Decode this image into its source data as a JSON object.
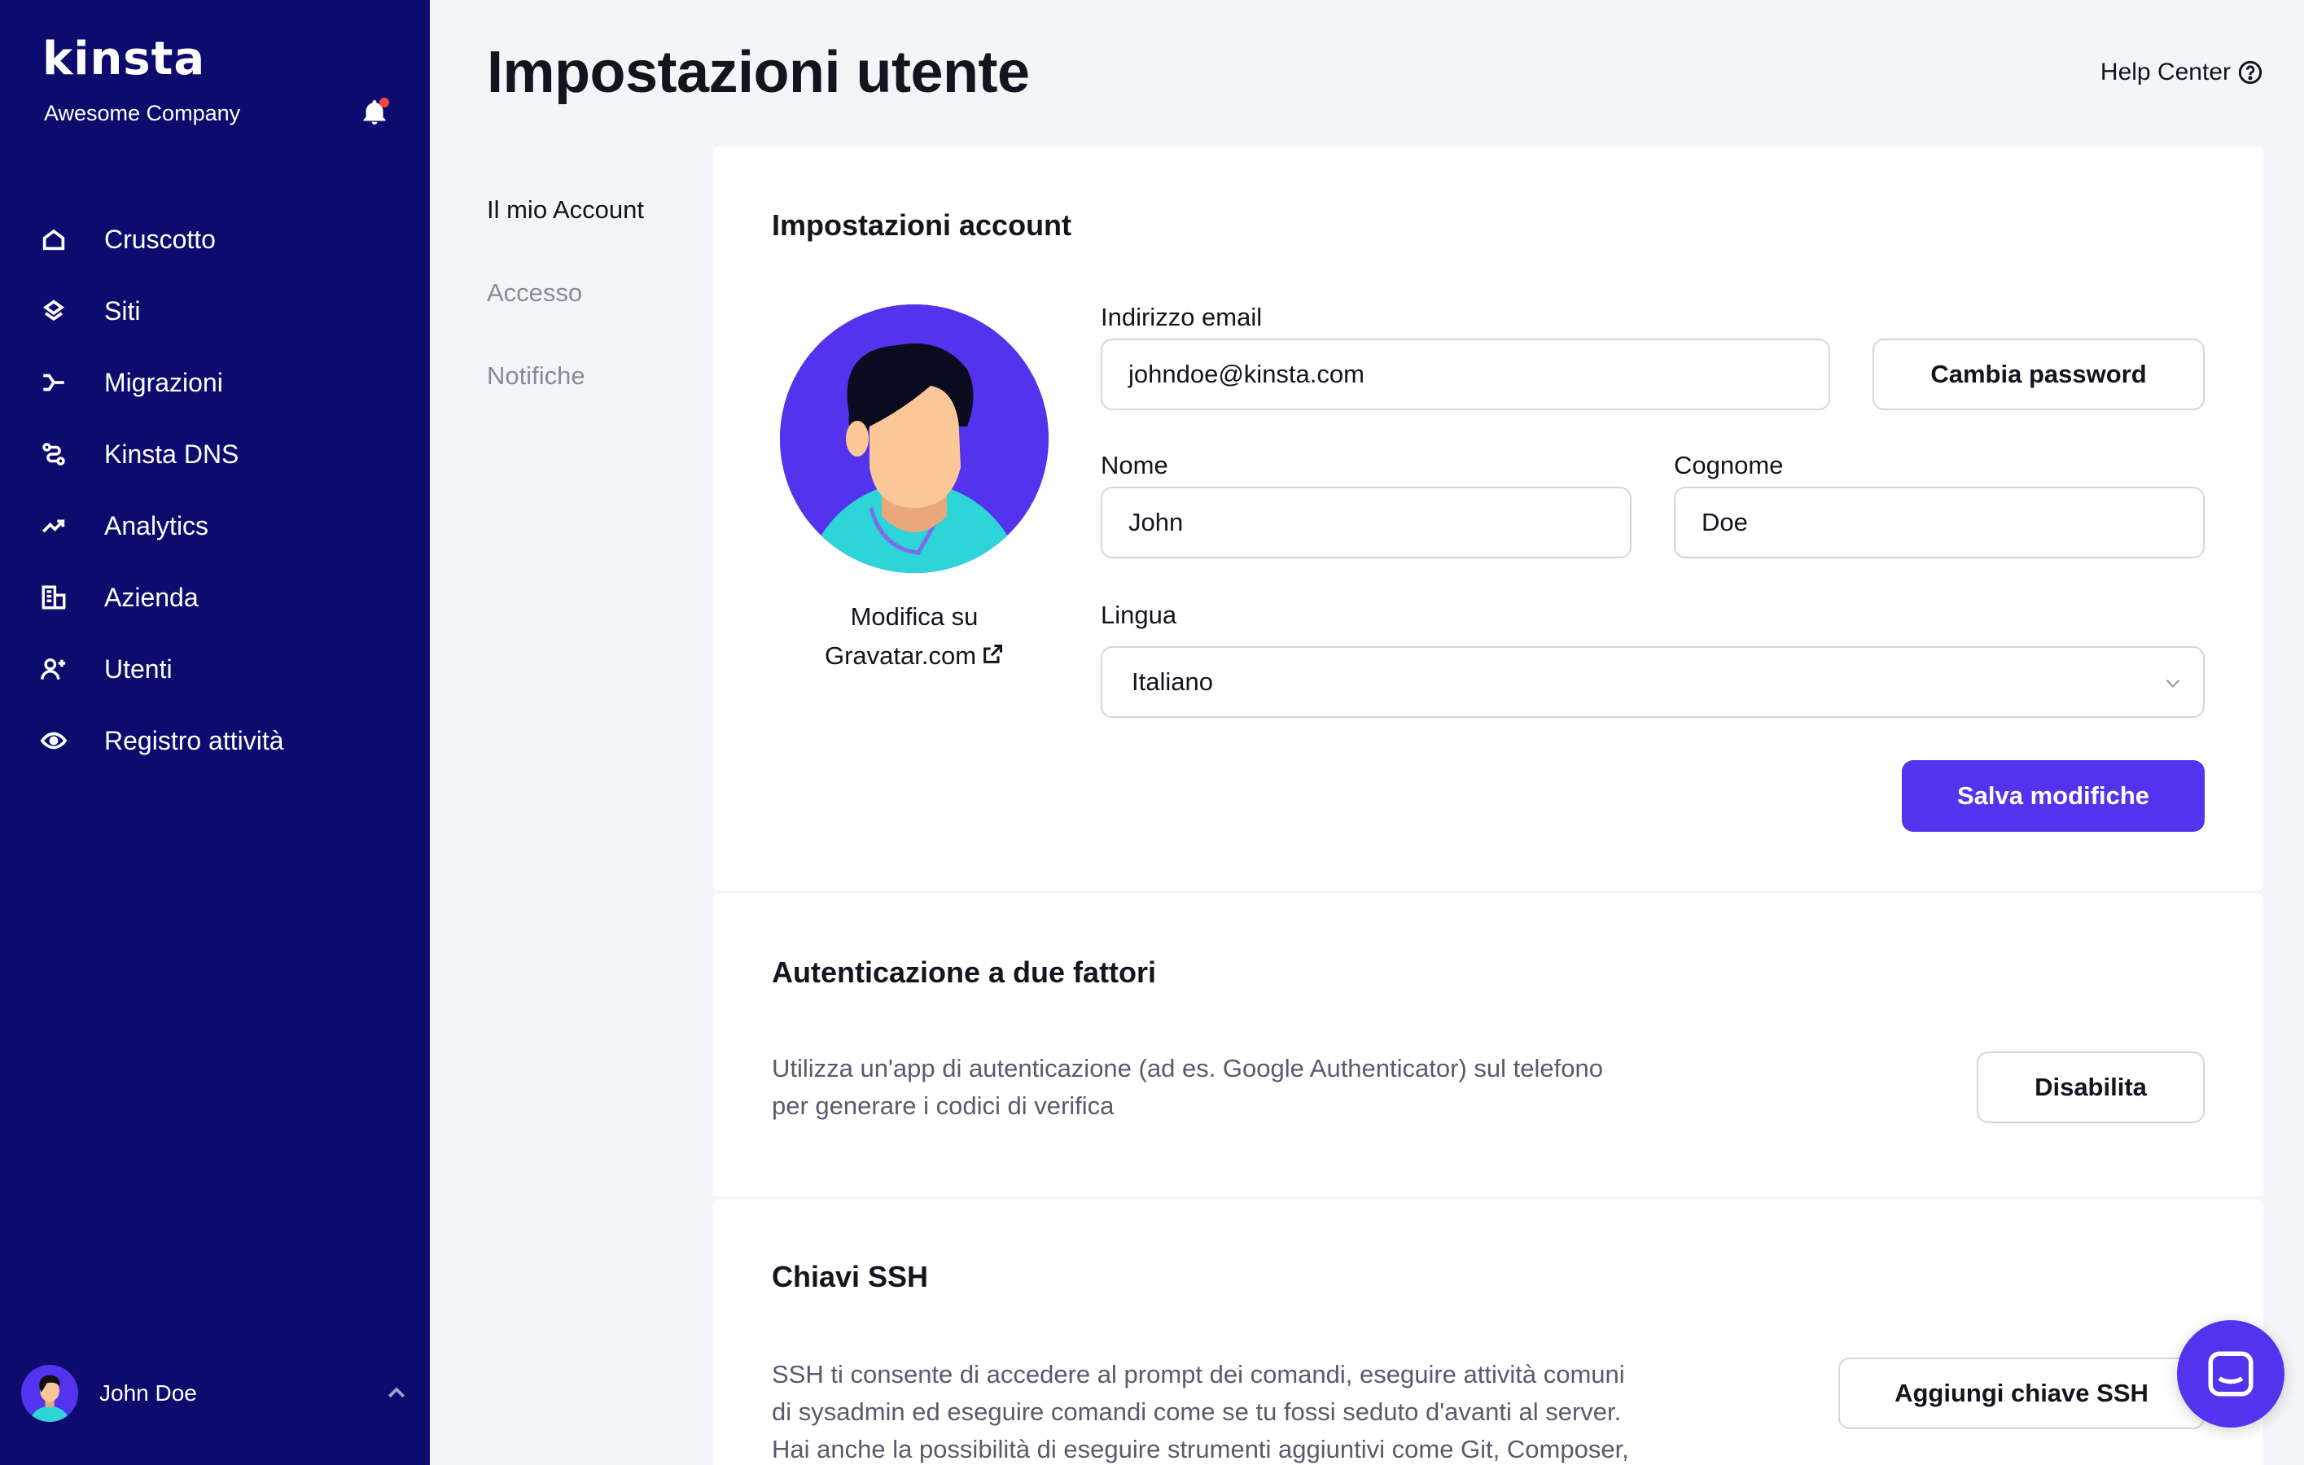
{
  "sidebar": {
    "logo": "kinsta",
    "company": "Awesome Company",
    "items": [
      {
        "label": "Cruscotto",
        "icon": "home-icon"
      },
      {
        "label": "Siti",
        "icon": "layers-icon"
      },
      {
        "label": "Migrazioni",
        "icon": "migration-icon"
      },
      {
        "label": "Kinsta DNS",
        "icon": "dns-icon"
      },
      {
        "label": "Analytics",
        "icon": "trend-icon"
      },
      {
        "label": "Azienda",
        "icon": "building-icon"
      },
      {
        "label": "Utenti",
        "icon": "user-add-icon"
      },
      {
        "label": "Registro attività",
        "icon": "eye-icon"
      }
    ],
    "user_name": "John Doe"
  },
  "header": {
    "title": "Impostazioni utente",
    "help": "Help Center"
  },
  "subnav": {
    "items": [
      "Il mio Account",
      "Accesso",
      "Notifiche"
    ]
  },
  "account": {
    "title": "Impostazioni account",
    "gravatar_line1": "Modifica su",
    "gravatar_line2": "Gravatar.com",
    "email_label": "Indirizzo email",
    "email_value": "johndoe@kinsta.com",
    "change_password": "Cambia password",
    "first_name_label": "Nome",
    "first_name_value": "John",
    "last_name_label": "Cognome",
    "last_name_value": "Doe",
    "language_label": "Lingua",
    "language_value": "Italiano",
    "save": "Salva modifiche"
  },
  "twofa": {
    "title": "Autenticazione a due fattori",
    "desc_line1": "Utilizza un'app di autenticazione (ad es. Google Authenticator) sul telefono",
    "desc_line2": "per generare i codici di verifica",
    "button": "Disabilita"
  },
  "ssh": {
    "title": "Chiavi SSH",
    "desc_line1": "SSH ti consente di accedere al prompt dei comandi, eseguire attività comuni",
    "desc_line2": "di sysadmin ed eseguire comandi come se tu fossi seduto d'avanti al server.",
    "desc_line3": "Hai anche la possibilità di eseguire strumenti aggiuntivi come Git, Composer,",
    "button": "Aggiungi chiave SSH"
  },
  "colors": {
    "sidebar": "#0d0c6e",
    "accent": "#5333ed",
    "notification_dot": "#f0463f"
  }
}
